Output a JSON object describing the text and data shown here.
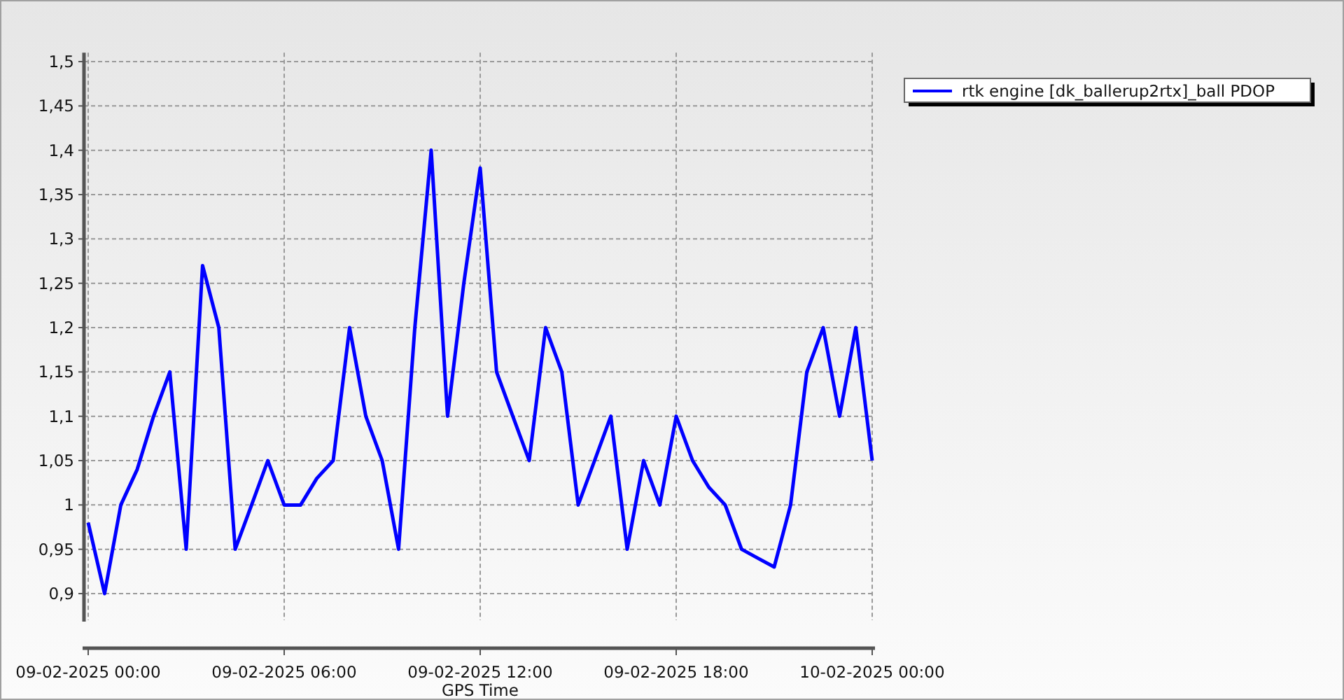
{
  "chart_data": {
    "type": "line",
    "xlabel": "GPS Time",
    "categories": [
      "09-02-2025 00:00",
      null,
      null,
      null,
      null,
      null,
      null,
      null,
      null,
      null,
      null,
      null,
      "09-02-2025 06:00",
      null,
      null,
      null,
      null,
      null,
      null,
      null,
      null,
      null,
      null,
      null,
      "09-02-2025 12:00",
      null,
      null,
      null,
      null,
      null,
      null,
      null,
      null,
      null,
      null,
      null,
      "09-02-2025 18:00",
      null,
      null,
      null,
      null,
      null,
      null,
      null,
      null,
      null,
      null,
      null,
      "10-02-2025 00:00"
    ],
    "series": [
      {
        "name": "rtk engine [dk_ballerup2rtx]_ball PDOP",
        "color": "#0000ff",
        "values": [
          0.98,
          0.9,
          1.0,
          1.04,
          1.1,
          1.15,
          0.95,
          1.27,
          1.2,
          0.95,
          1.0,
          1.05,
          1.0,
          1.0,
          1.03,
          1.05,
          1.2,
          1.1,
          1.05,
          0.95,
          1.2,
          1.4,
          1.1,
          1.25,
          1.38,
          1.15,
          1.1,
          1.05,
          1.2,
          1.15,
          1.0,
          1.05,
          1.1,
          0.95,
          1.05,
          1.0,
          1.1,
          1.05,
          1.02,
          1.0,
          0.95,
          0.94,
          0.93,
          1.0,
          1.15,
          1.2,
          1.1,
          1.2,
          1.05
        ]
      }
    ],
    "ylim": [
      0.87,
      1.51
    ],
    "grid": true,
    "yticks": [
      {
        "value": 0.9,
        "label": "0,9"
      },
      {
        "value": 0.95,
        "label": "0,95"
      },
      {
        "value": 1,
        "label": "1"
      },
      {
        "value": 1.05,
        "label": "1,05"
      },
      {
        "value": 1.1,
        "label": "1,1"
      },
      {
        "value": 1.15,
        "label": "1,15"
      },
      {
        "value": 1.2,
        "label": "1,2"
      },
      {
        "value": 1.25,
        "label": "1,25"
      },
      {
        "value": 1.3,
        "label": "1,3"
      },
      {
        "value": 1.35,
        "label": "1,35"
      },
      {
        "value": 1.4,
        "label": "1,4"
      },
      {
        "value": 1.45,
        "label": "1,45"
      },
      {
        "value": 1.5,
        "label": "1,5"
      }
    ]
  }
}
